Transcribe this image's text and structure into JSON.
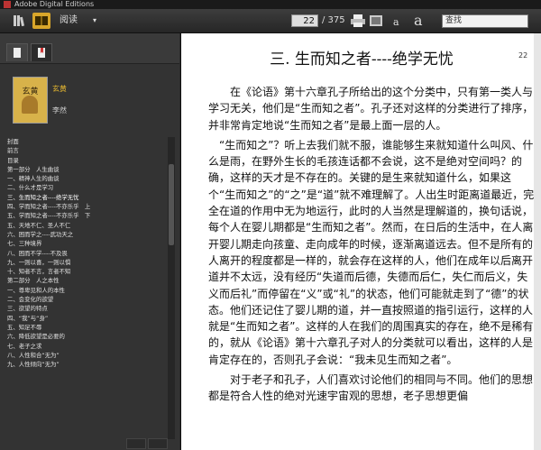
{
  "app": {
    "title": "Adobe Digital Editions"
  },
  "toolbar": {
    "mode_label": "阅读",
    "page_current": "22",
    "page_total": "/ 375",
    "font_small": "a",
    "font_large": "a",
    "search_placeholder": "查找"
  },
  "sidebar": {
    "book_title": "玄黄",
    "book_author": "李然",
    "cover_title": "玄黄",
    "toc": [
      "封面",
      "前言",
      "目录",
      "第一部分　人生曲谈",
      "一、精神人生的曲谈",
      "二、什么才是学习",
      "三、生而知之者----绝学无忧",
      "四、学而知之者----不亦乐乎　上",
      "五、学而知之者----不亦乐乎　下",
      "五、天地不仁、圣人不仁",
      "六、困而学之----武功天之",
      "七、三种境界",
      "八、困而不学----不及畏",
      "九、一则以喜，一则以惧",
      "十、知者不言，言者不知",
      "第二部分　人之本性",
      "一、尊卑见和人的本性",
      "二、会变化的欲望",
      "三、欲望的特点",
      "四、“我”与“身”",
      "五、知足不辱",
      "六、降低欲望是必要的",
      "七、老子之求",
      "八、人性和合“无为”",
      "九、人性倾向“无为”"
    ],
    "selected_index": 6
  },
  "page": {
    "heading": "三.  生而知之者----绝学无忧",
    "page_number": "22",
    "paragraphs": [
      "在《论语》第十六章孔子所给出的这个分类中，只有第一类人与学习无关，他们是“生而知之者”。孔子还对这样的分类进行了排序，并非常肯定地说“生而知之者”是最上面一层的人。",
      "“生而知之”？听上去我们就不服，谁能够生来就知道什么叫风、什么是雨，在野外生长的毛孩连话都不会说，这不是绝对空间吗？的确，这样的天才是不存在的。关键的是生来就知道什么，如果这个“生而知之”的“之”是“道”就不难理解了。人出生时距离道最近，完全在道的作用中无为地运行，此时的人当然是理解道的，换句话说，每个人在婴儿期都是“生而知之者”。然而，在日后的生活中，在人离开婴儿期走向孩童、走向成年的时候，逐渐离道远去。但不是所有的人离开的程度都是一样的，就会存在这样的人，他们在成年以后离开道并不太远，没有经历“失道而后德，失德而后仁，失仁而后义，失义而后礼”而停留在“义”或“礼”的状态，他们可能就走到了“德”的状态。他们还记住了婴儿期的道，并一直按照道的指引运行，这样的人就是“生而知之者”。这样的人在我们的周围真实的存在，绝不是稀有的，就从《论语》第十六章孔子对人的分类就可以看出，这样的人是肯定存在的，否则孔子会说：“我未见生而知之者”。",
      "对于老子和孔子，人们喜欢讨论他们的相同与不同。他们的思想都是符合人性的绝对光速宇宙观的思想，老子思想更偏"
    ]
  }
}
